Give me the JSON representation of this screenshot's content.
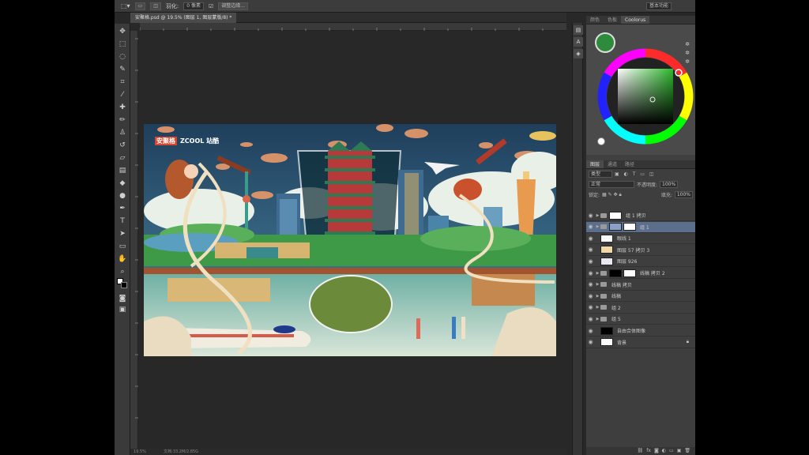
{
  "options": {
    "feather_label": "羽化:",
    "feather_value": "0 像素",
    "refine_label": "调整边缘...",
    "workspace": "基本功能"
  },
  "document": {
    "tab_title": "安聚格.psd @ 19.5% (图层 1, 图层蒙版/8) *"
  },
  "status": {
    "zoom": "19.5%",
    "doc_size": "文档:33.2M/2.85G"
  },
  "artwork": {
    "logo_a": "安聚格",
    "logo_b": "ZCOOL 站酷"
  },
  "color_panel": {
    "tabs": [
      "颜色",
      "色板",
      "Coolorus"
    ],
    "active_tab": 2,
    "foreground": "#2e8b3c"
  },
  "layers_panel": {
    "tabs": [
      "图层",
      "通道",
      "路径"
    ],
    "filter_label": "类型",
    "blend_mode": "正常",
    "opacity_label": "不透明度:",
    "opacity": "100%",
    "lock_label": "锁定:",
    "fill_label": "填充:",
    "fill": "100%",
    "layers": [
      {
        "name": "组 1 拷贝",
        "type": "group",
        "thumb": "#ffffff",
        "selected": false
      },
      {
        "name": "组 1",
        "type": "group-mask",
        "thumb": "#8aa0c8",
        "selected": true
      },
      {
        "name": "眼线 1",
        "type": "layer",
        "thumb": "#ffffff",
        "selected": false
      },
      {
        "name": "图层 57 拷贝 3",
        "type": "layer",
        "thumb": "#f0d8a8",
        "selected": false
      },
      {
        "name": "图层 926",
        "type": "layer",
        "thumb": "#e8e8f0",
        "selected": false
      },
      {
        "name": "线稿 拷贝 2",
        "type": "group-mask",
        "thumb": "#000000",
        "selected": false
      },
      {
        "name": "线稿 拷贝",
        "type": "group",
        "thumb": "",
        "selected": false
      },
      {
        "name": "线稿",
        "type": "group",
        "thumb": "",
        "selected": false
      },
      {
        "name": "组 2",
        "type": "group",
        "thumb": "",
        "selected": false
      },
      {
        "name": "组 5",
        "type": "group",
        "thumb": "",
        "selected": false
      },
      {
        "name": "自由合体图像",
        "type": "layer",
        "thumb": "#000000",
        "selected": false
      },
      {
        "name": "背景",
        "type": "background",
        "thumb": "#ffffff",
        "selected": false
      }
    ]
  }
}
